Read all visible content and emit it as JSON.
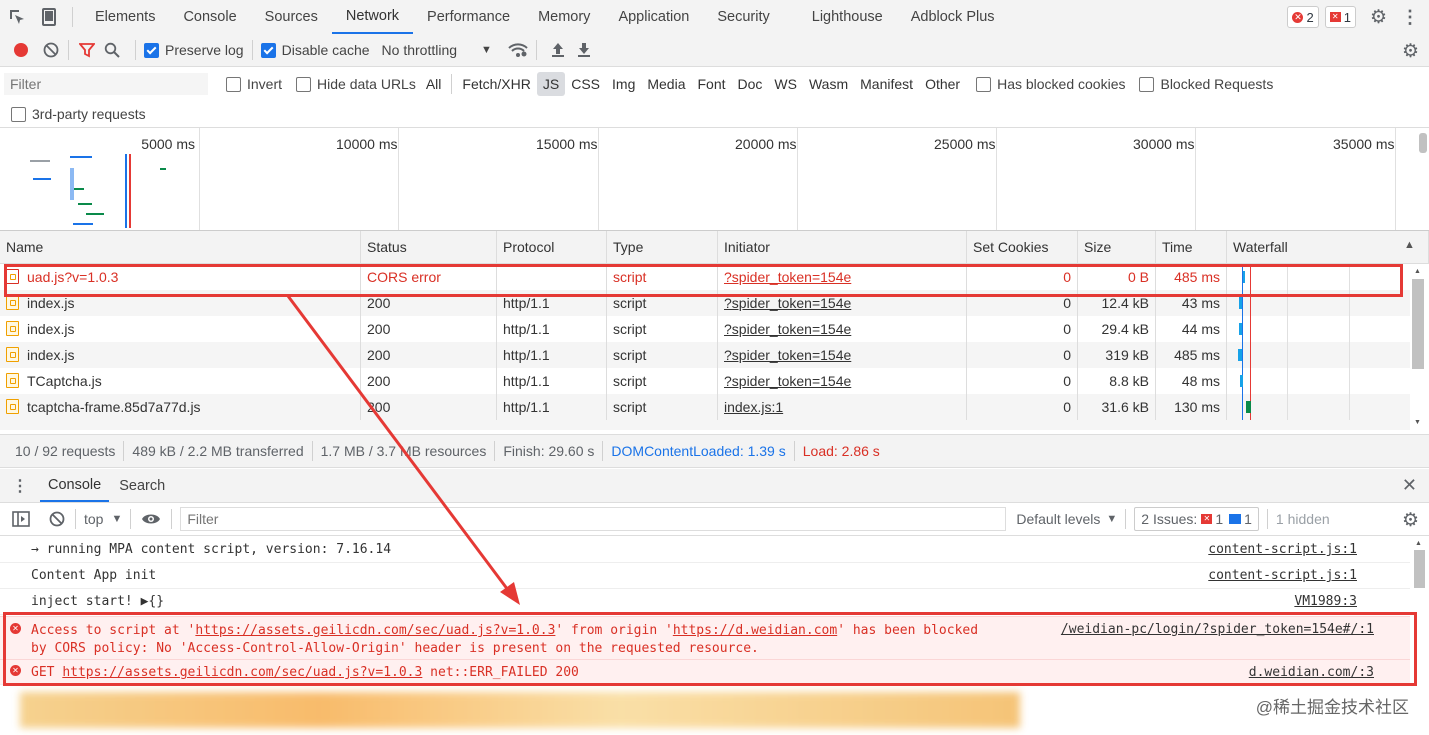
{
  "main_tabs": [
    "Elements",
    "Console",
    "Sources",
    "Network",
    "Performance",
    "Memory",
    "Application",
    "Security",
    "Lighthouse",
    "Adblock Plus"
  ],
  "active_tab": "Network",
  "badges": {
    "errors": "2",
    "issues": "1"
  },
  "toolbar": {
    "preserve_log": "Preserve log",
    "disable_cache": "Disable cache",
    "throttling": "No throttling"
  },
  "filter_bar": {
    "placeholder": "Filter",
    "invert": "Invert",
    "hide_data_urls": "Hide data URLs",
    "types": [
      "All",
      "Fetch/XHR",
      "JS",
      "CSS",
      "Img",
      "Media",
      "Font",
      "Doc",
      "WS",
      "Wasm",
      "Manifest",
      "Other"
    ],
    "active_type": "JS",
    "has_blocked_cookies": "Has blocked cookies",
    "blocked_requests": "Blocked Requests",
    "third_party": "3rd-party requests"
  },
  "overview": {
    "ticks": [
      "5000 ms",
      "10000 ms",
      "15000 ms",
      "20000 ms",
      "25000 ms",
      "30000 ms",
      "35000 ms"
    ]
  },
  "table": {
    "columns": [
      "Name",
      "Status",
      "Protocol",
      "Type",
      "Initiator",
      "Set Cookies",
      "Size",
      "Time",
      "Waterfall"
    ],
    "rows": [
      {
        "name": "uad.js?v=1.0.3",
        "status": "CORS error",
        "protocol": "",
        "type": "script",
        "initiator": "?spider_token=154e",
        "cookies": "0",
        "size": "0 B",
        "time": "485 ms",
        "error": true
      },
      {
        "name": "index.js",
        "status": "200",
        "protocol": "http/1.1",
        "type": "script",
        "initiator": "?spider_token=154e",
        "cookies": "0",
        "size": "12.4 kB",
        "time": "43 ms"
      },
      {
        "name": "index.js",
        "status": "200",
        "protocol": "http/1.1",
        "type": "script",
        "initiator": "?spider_token=154e",
        "cookies": "0",
        "size": "29.4 kB",
        "time": "44 ms"
      },
      {
        "name": "index.js",
        "status": "200",
        "protocol": "http/1.1",
        "type": "script",
        "initiator": "?spider_token=154e",
        "cookies": "0",
        "size": "319 kB",
        "time": "485 ms"
      },
      {
        "name": "TCaptcha.js",
        "status": "200",
        "protocol": "http/1.1",
        "type": "script",
        "initiator": "?spider_token=154e",
        "cookies": "0",
        "size": "8.8 kB",
        "time": "48 ms"
      },
      {
        "name": "tcaptcha-frame.85d7a77d.js",
        "status": "200",
        "protocol": "http/1.1",
        "type": "script",
        "initiator": "index.js:1",
        "cookies": "0",
        "size": "31.6 kB",
        "time": "130 ms"
      }
    ]
  },
  "status_bar": {
    "requests": "10 / 92 requests",
    "transferred": "489 kB / 2.2 MB transferred",
    "resources": "1.7 MB / 3.7 MB resources",
    "finish": "Finish: 29.60 s",
    "dcl": "DOMContentLoaded: 1.39 s",
    "load": "Load: 2.86 s"
  },
  "drawer": {
    "tabs": [
      "Console",
      "Search"
    ],
    "context": "top",
    "filter_placeholder": "Filter",
    "levels": "Default levels",
    "issues_label": "2 Issues:",
    "issues_err": "1",
    "issues_info": "1",
    "hidden": "1 hidden"
  },
  "console": {
    "lines": [
      {
        "text": "→ running MPA content script, version: 7.16.14",
        "source": "content-script.js:1"
      },
      {
        "text": "Content App init",
        "source": "content-script.js:1"
      },
      {
        "text": "inject start! ▶{}",
        "source": "VM1989:3"
      }
    ],
    "error1": {
      "pre": "Access to script at '",
      "url1": "https://assets.geilicdn.com/sec/uad.js?v=1.0.3",
      "mid": "' from origin '",
      "url2": "https://d.weidian.com",
      "post": "' has been blocked",
      "line2": "by CORS policy: No 'Access-Control-Allow-Origin' header is present on the requested resource.",
      "source": "/weidian-pc/login/?spider_token=154e#/:1"
    },
    "error2": {
      "pre": "GET ",
      "url": "https://assets.geilicdn.com/sec/uad.js?v=1.0.3",
      "post": " net::ERR_FAILED 200",
      "source": "d.weidian.com/:3"
    }
  },
  "watermark": "@稀土掘金技术社区",
  "colors": {
    "annotation": "#e53935",
    "error_bg": "#fff0f0",
    "error_text": "#d93025",
    "accent": "#1a73e8"
  }
}
